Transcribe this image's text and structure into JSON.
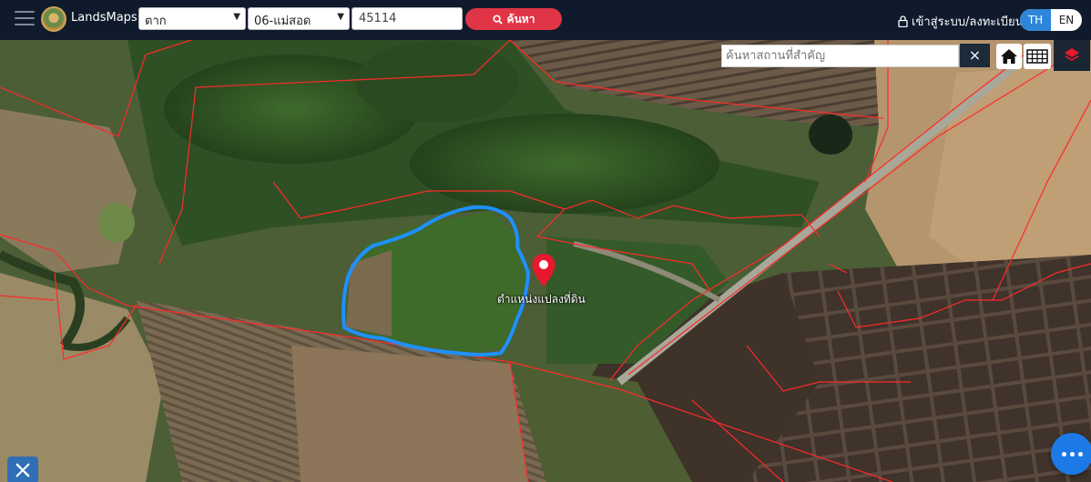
{
  "app": {
    "title": "LandsMaps"
  },
  "search": {
    "province_selected": "ตาก",
    "district_selected": "06-แม่สอด",
    "parcel_value": "45114",
    "search_button_label": "ค้นหา"
  },
  "header": {
    "login_label": "เข้าสู่ระบบ/ลงทะเบียน",
    "lang_th": "TH",
    "lang_en": "EN",
    "active_lang": "TH"
  },
  "map": {
    "place_search_placeholder": "ค้นหาสถานที่สำคัญ",
    "clear_label": "×",
    "marker_label": "ตำแหน่งแปลงที่ดิน",
    "icons": [
      "menu-icon",
      "search-icon",
      "lock-icon",
      "home-icon",
      "grid-icon",
      "layers-icon",
      "ruler-tool-icon",
      "more-icon",
      "map-pin-icon"
    ],
    "colors": {
      "parcel_outline": "#1e90ff",
      "boundary_lines": "#ff2a2a",
      "marker": "#e8192c",
      "nav_bg": "#0f1b2c",
      "accent": "#2e86d9"
    }
  }
}
